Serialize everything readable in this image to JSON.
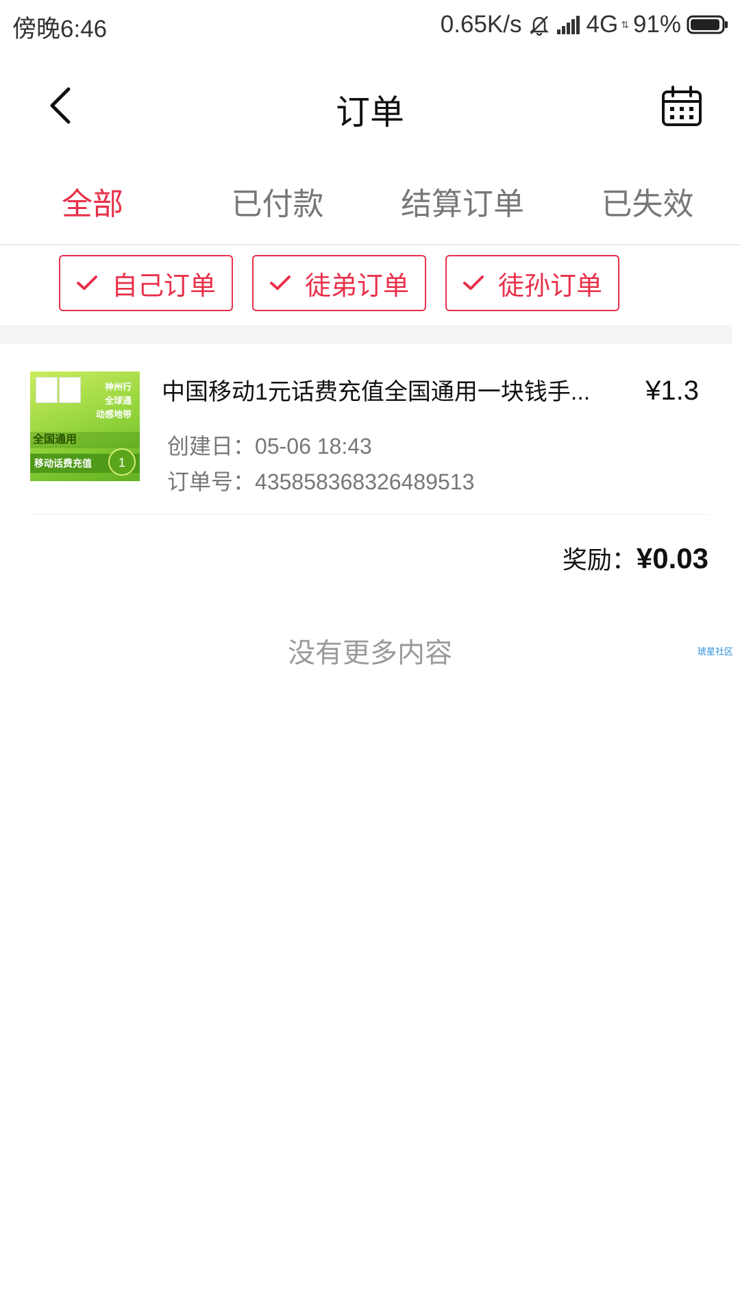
{
  "status_bar": {
    "time": "傍晚6:46",
    "network_speed": "0.65K/s",
    "network_type": "4G",
    "battery": "91%"
  },
  "header": {
    "title": "订单",
    "back_icon": "chevron-left-icon",
    "calendar_icon": "calendar-icon"
  },
  "tabs": [
    {
      "label": "全部",
      "active": true
    },
    {
      "label": "已付款",
      "active": false
    },
    {
      "label": "结算订单",
      "active": false
    },
    {
      "label": "已失效",
      "active": false
    }
  ],
  "filters": [
    {
      "label": "自己订单",
      "checked": true
    },
    {
      "label": "徒弟订单",
      "checked": true
    },
    {
      "label": "徒孙订单",
      "checked": true
    }
  ],
  "order": {
    "title": "中国移动1元话费充值全国通用一块钱手...",
    "price": "¥1.3",
    "created_label": "创建日：",
    "created_value": "05-06 18:43",
    "order_no_label": "订单号：",
    "order_no_value": "435858368326489513",
    "reward_label": "奖励：",
    "reward_value": "¥0.03",
    "thumb_text": {
      "line1": "神州行",
      "line2": "全球通",
      "line3": "动感地带",
      "band1": "全国通用",
      "band2": "移动话费充值",
      "badge": "1"
    }
  },
  "footer": {
    "no_more": "没有更多内容",
    "watermark": "琥星社区"
  },
  "colors": {
    "accent": "#e8304a",
    "text_primary": "#111111",
    "text_secondary": "#777777",
    "divider": "#f4f4f4"
  }
}
